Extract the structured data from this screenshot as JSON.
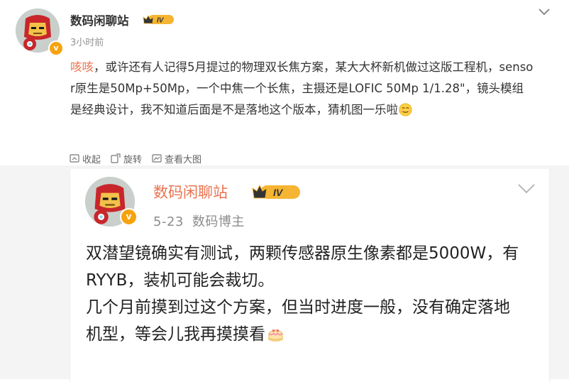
{
  "post": {
    "author": "数码闲聊站",
    "level": "IV",
    "verified": "v",
    "time": "3小时前",
    "tag": "咳咳",
    "text": "，或许还有人记得5月提过的物理双长焦方案，某大大杯新机做过这版工程机，sensor原生是50Mp+50Mp，一个中焦一个长焦，主摄还是LOFIC 50Mp 1/1.28\"，镜头模组是经典设计，我不知道后面是不是落地这个版本，猜机图一乐啦",
    "emoji": "smile-emoji"
  },
  "actions": [
    {
      "label": "收起",
      "icon": "collapse-icon"
    },
    {
      "label": "旋转",
      "icon": "rotate-icon"
    },
    {
      "label": "查看大图",
      "icon": "view-large-icon"
    }
  ],
  "quoted": {
    "author": "数码闲聊站",
    "level": "IV",
    "verified": "v",
    "date": "5-23",
    "role": "数码博主",
    "text": "双潜望镜确实有测试，两颗传感器原生像素都是5000W，有RYYB，装机可能会裁切。\n几个月前摸到过这个方案，但当时进度一般，没有确定落地机型，等会儿我再摸摸看",
    "emoji": "cake-emoji"
  },
  "colors": {
    "accent": "#eb7350",
    "badge_orange": "#f6a30f",
    "level_gold": "#f5b431",
    "text": "#333333",
    "muted": "#939393"
  }
}
